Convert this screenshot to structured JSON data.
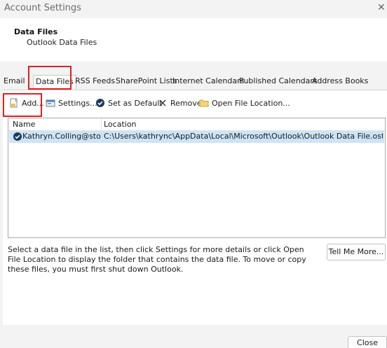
{
  "window": {
    "title": "Account Settings",
    "close_glyph": "✕"
  },
  "header": {
    "title": "Data Files",
    "subtitle": "Outlook Data Files"
  },
  "tabs": [
    {
      "label": "Email",
      "active": false
    },
    {
      "label": "Data Files",
      "active": true
    },
    {
      "label": "RSS Feeds",
      "active": false
    },
    {
      "label": "SharePoint Lists",
      "active": false
    },
    {
      "label": "Internet Calendars",
      "active": false
    },
    {
      "label": "Published Calendars",
      "active": false
    },
    {
      "label": "Address Books",
      "active": false
    }
  ],
  "toolbar": {
    "add": {
      "label": "Add...",
      "icon": "add-file-icon"
    },
    "settings": {
      "label": "Settings...",
      "icon": "settings-icon"
    },
    "set_default": {
      "label": "Set as Default",
      "icon": "checkmark-circle-icon"
    },
    "remove": {
      "label": "Remove",
      "icon": "x-icon"
    },
    "open_location": {
      "label": "Open File Location...",
      "icon": "folder-icon"
    }
  },
  "list": {
    "columns": [
      "Name",
      "Location"
    ],
    "rows": [
      {
        "name": "Kathryn.Colling@story...",
        "location": "C:\\Users\\kathrync\\AppData\\Local\\Microsoft\\Outlook\\Outlook Data File.ost",
        "is_default": true
      }
    ]
  },
  "description": "Select a data file in the list, then click Settings for more details or click Open File Location to display the folder that contains the data file. To move or copy these files, you must first shut down Outlook.",
  "buttons": {
    "tell_me_more": "Tell Me More...",
    "close": "Close"
  },
  "colors": {
    "highlight": "#e02020",
    "selected_row": "#cce4f7",
    "accent": "#1f3a5f"
  }
}
